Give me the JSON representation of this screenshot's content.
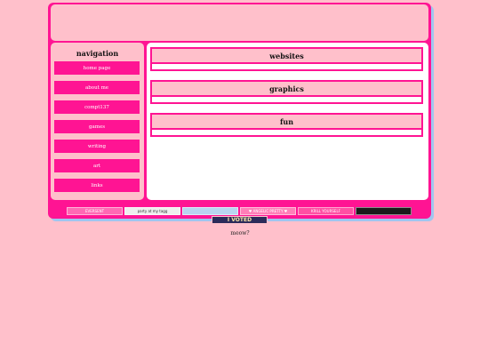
{
  "navigation": {
    "title": "navigation",
    "items": [
      {
        "label": "home page"
      },
      {
        "label": "about me"
      },
      {
        "label": "compt137"
      },
      {
        "label": "games"
      },
      {
        "label": "writing"
      },
      {
        "label": "art"
      },
      {
        "label": "links"
      }
    ]
  },
  "sections": [
    {
      "title": "websites"
    },
    {
      "title": "graphics"
    },
    {
      "title": "fun"
    }
  ],
  "stamps": [
    {
      "text": "EVERSENT",
      "color": "#ff69b4"
    },
    {
      "text": "party at my tagg",
      "color": "#5a4a4a"
    },
    {
      "text": "",
      "color": "#b9d4f0"
    },
    {
      "text": "♥ ANGELIC PRETTY ♥",
      "color": "#ff7fb8"
    },
    {
      "text": "KRILL YOURSELF",
      "color": "#ff4fa3"
    },
    {
      "text": "",
      "color": "#1a1a1a"
    }
  ],
  "badge": {
    "text": "I VOTED"
  },
  "footer": {
    "text": "meow?"
  },
  "colors": {
    "background": "#ffc0cb",
    "accent": "#ff1493",
    "shadow": "#9fc6f0"
  }
}
